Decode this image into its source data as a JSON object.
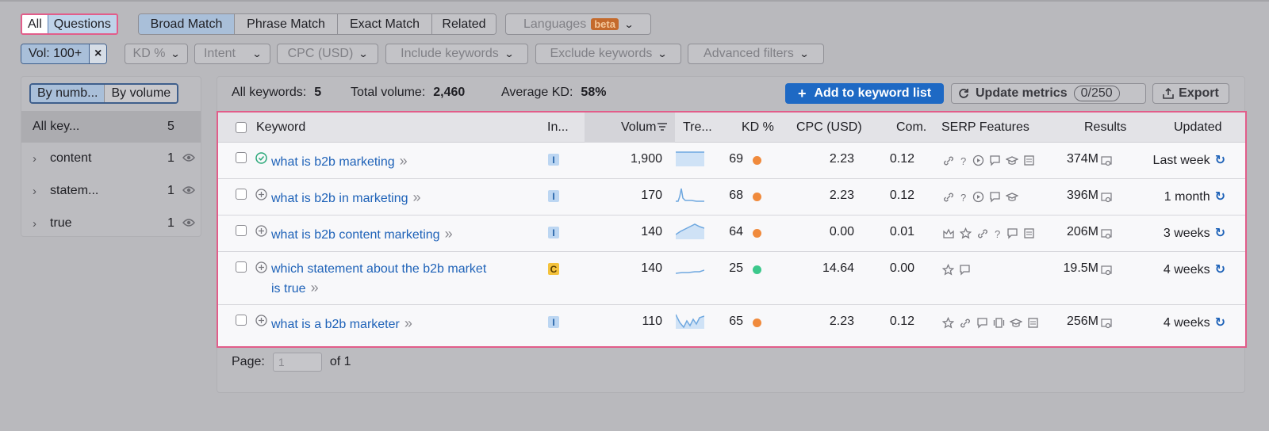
{
  "tabs": {
    "all": "All",
    "questions": "Questions"
  },
  "match": [
    "Broad Match",
    "Phrase Match",
    "Exact Match",
    "Related"
  ],
  "languages": {
    "label": "Languages",
    "badge": "beta"
  },
  "filters": {
    "vol_chip": "Vol: 100+",
    "vol_clear": "×",
    "kd": "KD %",
    "intent": "Intent",
    "cpc": "CPC (USD)",
    "include": "Include keywords",
    "exclude": "Exclude keywords",
    "advanced": "Advanced filters"
  },
  "left_panel": {
    "by_number": "By numb...",
    "by_volume": "By volume",
    "groups": [
      {
        "label": "All key...",
        "count": "5"
      },
      {
        "label": "content",
        "count": "1"
      },
      {
        "label": "statem...",
        "count": "1"
      },
      {
        "label": "true",
        "count": "1"
      }
    ]
  },
  "summary": {
    "all_keywords_label": "All keywords:",
    "all_keywords_value": "5",
    "total_volume_label": "Total volume:",
    "total_volume_value": "2,460",
    "avg_kd_label": "Average KD:",
    "avg_kd_value": "58%"
  },
  "actions": {
    "add": "Add to keyword list",
    "update": "Update metrics",
    "update_count": "0/250",
    "export": "Export"
  },
  "columns": {
    "keyword": "Keyword",
    "intent": "In...",
    "volume": "Volum",
    "trend": "Tre...",
    "kd": "KD %",
    "cpc": "CPC (USD)",
    "com": "Com.",
    "serp": "SERP Features",
    "results": "Results",
    "updated": "Updated"
  },
  "rows": [
    {
      "keyword_line1": "what is b2b marketing",
      "keyword_line2": "",
      "intent": "I",
      "volume": "1,900",
      "kd": "69",
      "kd_color": "#f08a3c",
      "cpc": "2.23",
      "com": "0.12",
      "results": "374M",
      "updated": "Last week",
      "serp_icons": [
        "link-icon",
        "question-icon",
        "video-icon",
        "review-icon",
        "education-icon",
        "ads-icon"
      ]
    },
    {
      "keyword_line1": "what is b2b in marketing",
      "keyword_line2": "",
      "intent": "I",
      "volume": "170",
      "kd": "68",
      "kd_color": "#f08a3c",
      "cpc": "2.23",
      "com": "0.12",
      "results": "396M",
      "updated": "1 month",
      "serp_icons": [
        "link-icon",
        "question-icon",
        "video-icon",
        "review-icon",
        "education-icon"
      ]
    },
    {
      "keyword_line1": "what is b2b content marketing",
      "keyword_line2": "",
      "intent": "I",
      "volume": "140",
      "kd": "64",
      "kd_color": "#f08a3c",
      "cpc": "0.00",
      "com": "0.01",
      "results": "206M",
      "updated": "3 weeks",
      "serp_icons": [
        "crown-icon",
        "star-icon",
        "link-icon",
        "question-icon",
        "review-icon",
        "ads-icon"
      ]
    },
    {
      "keyword_line1": "which statement about the b2b market",
      "keyword_line2": "is true",
      "intent": "C",
      "volume": "140",
      "kd": "25",
      "kd_color": "#3cc88c",
      "cpc": "14.64",
      "com": "0.00",
      "results": "19.5M",
      "updated": "4 weeks",
      "serp_icons": [
        "star-icon",
        "review-icon"
      ]
    },
    {
      "keyword_line1": "what is a b2b marketer",
      "keyword_line2": "",
      "intent": "I",
      "volume": "110",
      "kd": "65",
      "kd_color": "#f08a3c",
      "cpc": "2.23",
      "com": "0.12",
      "results": "256M",
      "updated": "4 weeks",
      "serp_icons": [
        "star-icon",
        "link-icon",
        "review-icon",
        "carousel-icon",
        "education-icon",
        "ads-icon"
      ]
    }
  ],
  "pager": {
    "label": "Page:",
    "value": "1",
    "of": "of 1"
  },
  "colors": {
    "accent": "#1e69c4",
    "highlight_border": "#e25d8a",
    "link": "#1e62b8"
  }
}
